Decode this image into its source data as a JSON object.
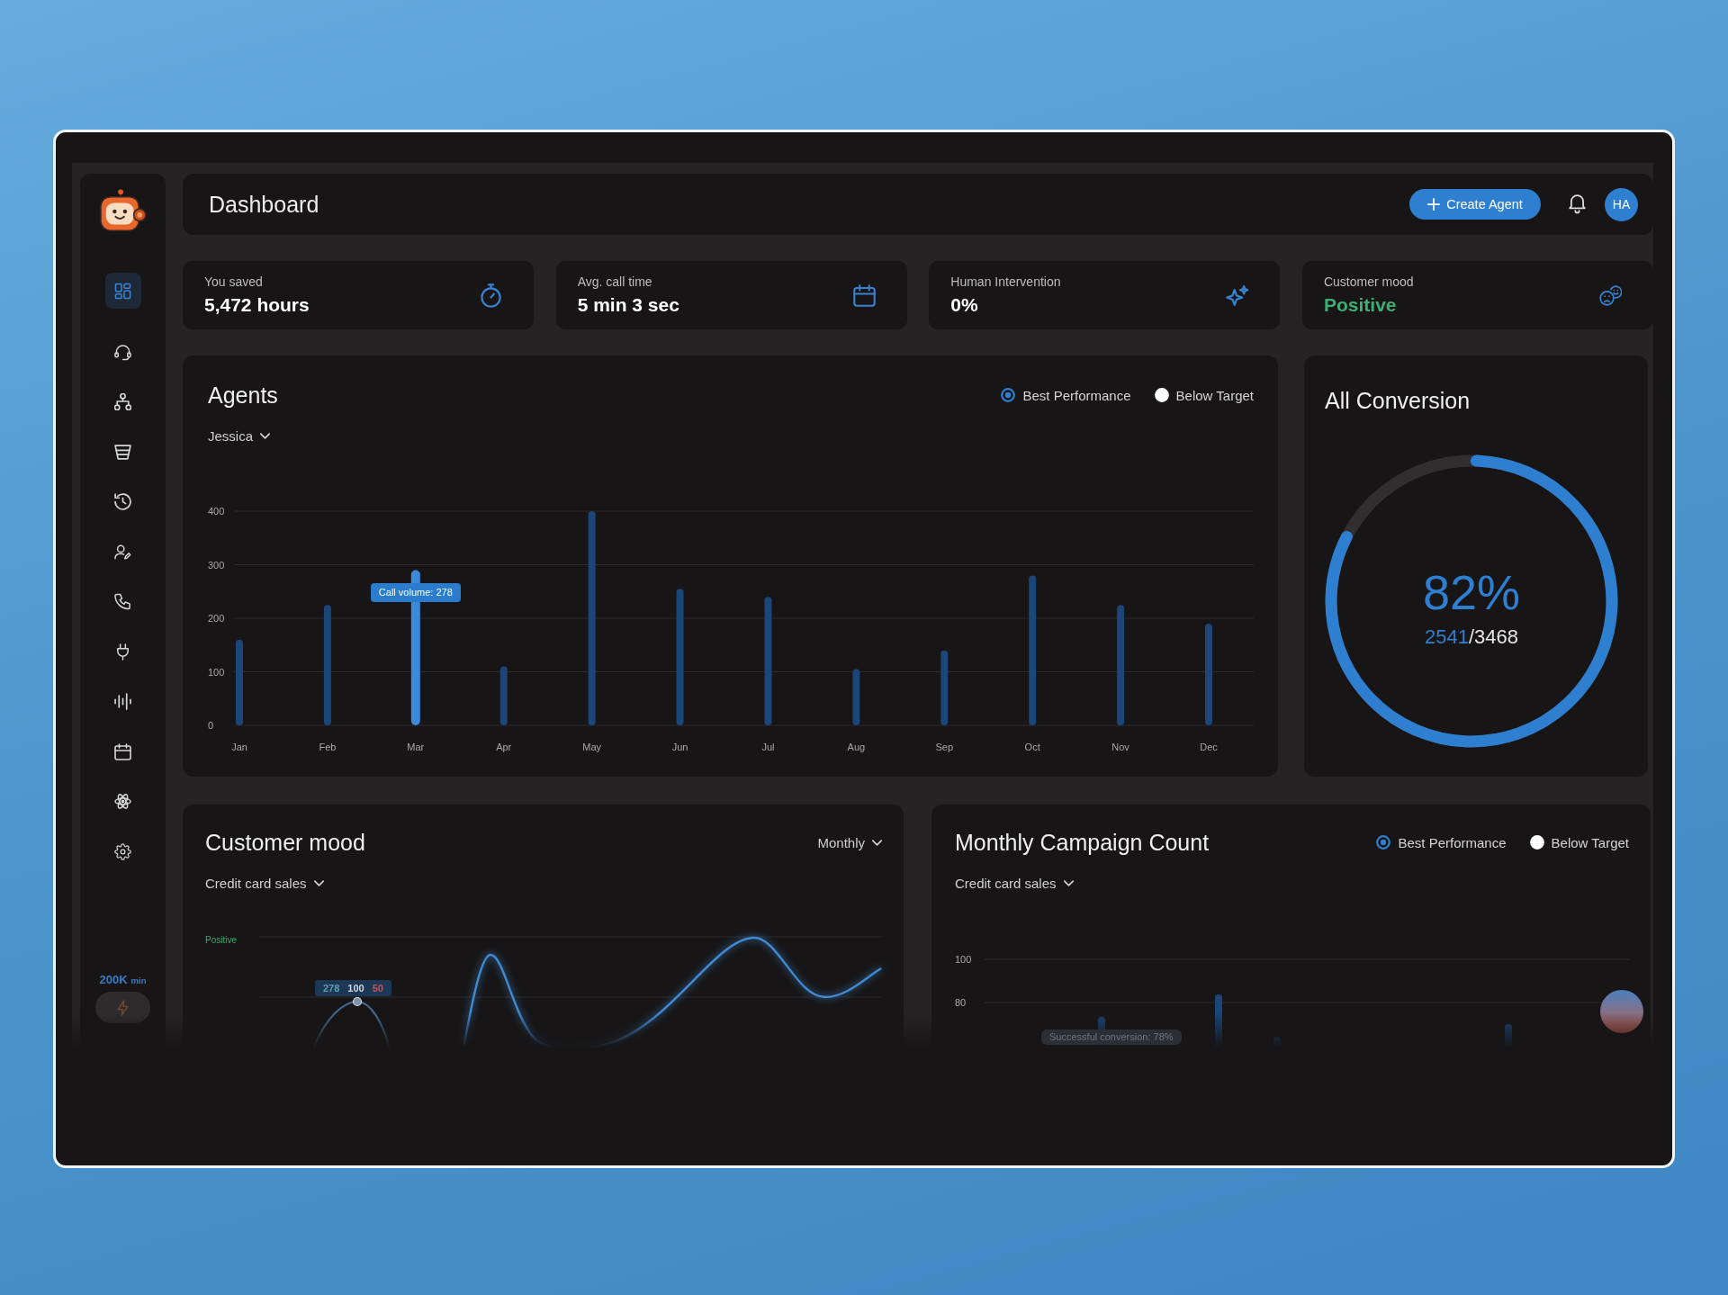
{
  "sidebar": {
    "items": [
      {
        "selected": true
      },
      {
        "selected": false
      },
      {
        "selected": false
      },
      {
        "selected": false
      },
      {
        "selected": false
      },
      {
        "selected": false
      },
      {
        "selected": false
      },
      {
        "selected": false
      },
      {
        "selected": false
      },
      {
        "selected": false
      },
      {
        "selected": false
      },
      {
        "selected": false
      }
    ],
    "usage": "200K",
    "usage_unit": "min"
  },
  "header": {
    "title": "Dashboard",
    "create_button": "Create Agent",
    "avatar": "HA"
  },
  "stats": [
    {
      "label": "You saved",
      "value": "5,472 hours",
      "color": "#ffffff"
    },
    {
      "label": "Avg. call time",
      "value": "5 min 3 sec",
      "color": "#ffffff"
    },
    {
      "label": "Human Intervention",
      "value": "0%",
      "color": "#ffffff"
    },
    {
      "label": "Customer mood",
      "value": "Positive",
      "color": "#3daf74"
    }
  ],
  "agents": {
    "title": "Agents",
    "legend": [
      {
        "label": "Best Performance",
        "selected": true
      },
      {
        "label": "Below Target",
        "selected": false
      }
    ],
    "filter": "Jessica",
    "chart_data": {
      "type": "bar",
      "categories": [
        "Jan",
        "Feb",
        "Mar",
        "Apr",
        "May",
        "Jun",
        "Jul",
        "Aug",
        "Sep",
        "Oct",
        "Nov",
        "Dec"
      ],
      "values": [
        160,
        225,
        290,
        110,
        400,
        255,
        240,
        105,
        140,
        280,
        225,
        190
      ],
      "ylim": [
        0,
        400
      ],
      "yticks": [
        0,
        100,
        200,
        300,
        400
      ],
      "grid": true,
      "annotations": [
        {
          "x": "Mar",
          "text": "Call volume: 278"
        }
      ]
    }
  },
  "conversion": {
    "title": "All Conversion",
    "percent": "82%",
    "converted": "2541",
    "total": "/3468",
    "level": 0.82
  },
  "customer_mood": {
    "title": "Customer mood",
    "period": "Monthly",
    "filter": "Credit card sales",
    "axis_label": "Positive",
    "tooltip": [
      {
        "text": "278",
        "color": "#5f9fb0"
      },
      {
        "text": "100",
        "color": "#d0d4d8"
      },
      {
        "text": "50",
        "color": "#c0565c"
      }
    ]
  },
  "campaign": {
    "title": "Monthly Campaign Count",
    "legend": [
      {
        "label": "Best Performance",
        "selected": true
      },
      {
        "label": "Below Target",
        "selected": false
      }
    ],
    "filter": "Credit card sales",
    "yticks": [
      "100",
      "80"
    ],
    "tooltip": "Successful conversion: 78%"
  }
}
